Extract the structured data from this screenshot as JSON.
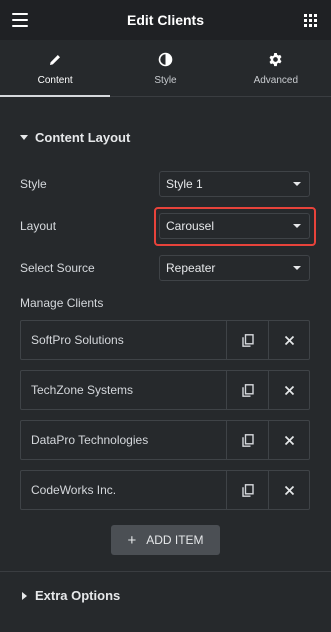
{
  "header": {
    "title": "Edit Clients"
  },
  "tabs": [
    {
      "label": "Content",
      "icon": "pencil-icon",
      "active": true
    },
    {
      "label": "Style",
      "icon": "half-circle-icon",
      "active": false
    },
    {
      "label": "Advanced",
      "icon": "gear-icon",
      "active": false
    }
  ],
  "content_layout": {
    "title": "Content Layout",
    "fields": [
      {
        "label": "Style",
        "value": "Style 1"
      },
      {
        "label": "Layout",
        "value": "Carousel"
      },
      {
        "label": "Select Source",
        "value": "Repeater"
      }
    ],
    "highlight_color": "#e8433b"
  },
  "manage_clients": {
    "label": "Manage Clients",
    "items": [
      {
        "name": "SoftPro Solutions"
      },
      {
        "name": "TechZone Systems"
      },
      {
        "name": "DataPro Technologies"
      },
      {
        "name": "CodeWorks Inc."
      }
    ],
    "add_label": "ADD ITEM"
  },
  "extra_options": {
    "title": "Extra Options"
  }
}
